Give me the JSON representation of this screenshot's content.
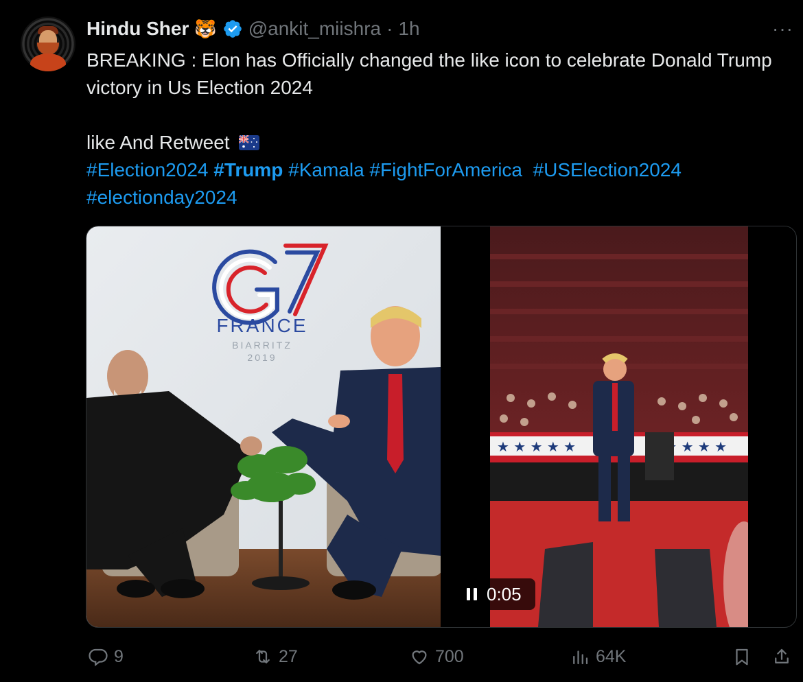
{
  "author": {
    "name": "Hindu Sher",
    "badge_emoji": "🐯",
    "handle": "@ankit_miishra",
    "separator": "·",
    "time": "1h"
  },
  "more_label": "···",
  "text": {
    "line1": "BREAKING : Elon has Officially changed the like icon to celebrate Donald Trump victory in Us Election 2024",
    "line2": "like And Retweet",
    "flag_icon": "australia-flag-icon",
    "hashtags": [
      "#Election2024",
      "#Trump",
      "#Kamala",
      "#FightForAmerica",
      "#USElection2024",
      "#electionday2024"
    ]
  },
  "media": {
    "left_image": {
      "logo_text": "G7",
      "country": "FRANCE",
      "city": "BIARRITZ",
      "year": "2019"
    },
    "video": {
      "timestamp": "0:05",
      "control_icon": "pause-icon"
    }
  },
  "actions": {
    "reply_count": "9",
    "retweet_count": "27",
    "like_count": "700",
    "views_count": "64K"
  },
  "colors": {
    "background": "#000000",
    "text": "#e7e9ea",
    "muted": "#71767b",
    "link": "#1d9bf0",
    "verified": "#1d9bf0"
  }
}
